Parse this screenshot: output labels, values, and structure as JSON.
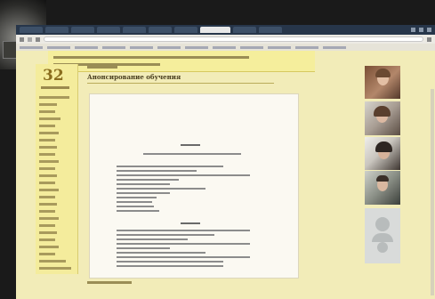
{
  "sidebar": {
    "day_number": "32"
  },
  "main": {
    "page_title": "Анонсирование обучения"
  },
  "colors": {
    "page_background": "#f2ecb8",
    "tab_bar": "#27364a",
    "header_accent": "#8a6d1e"
  },
  "icons": {
    "window_controls": [
      "minimize-icon",
      "maximize-icon",
      "close-icon"
    ],
    "avatar_placeholder": "person-icon"
  }
}
